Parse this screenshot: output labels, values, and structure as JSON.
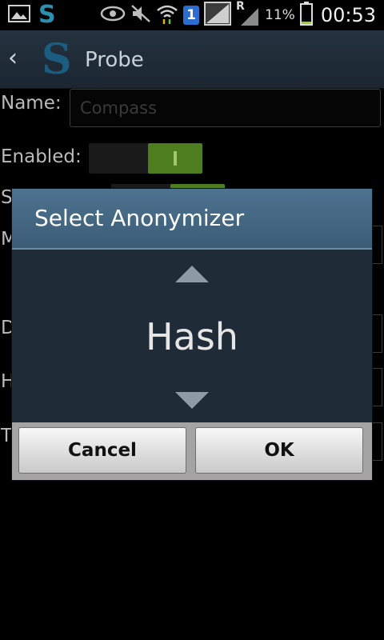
{
  "status_bar": {
    "left_icons": [
      "image-icon",
      "app-s-icon"
    ],
    "right_icons": [
      "eye-icon",
      "mute-icon",
      "wifi-icon",
      "sim-1-icon",
      "signal-icon",
      "roaming-icon"
    ],
    "app_letter": "S",
    "sim_label": "1",
    "roaming_label": "R",
    "battery_percent": "11%",
    "time": "00:53"
  },
  "action_bar": {
    "logo_letter": "S",
    "title": "Probe"
  },
  "form": {
    "name_label": "Name:",
    "name_value": "Compass",
    "enabled_label": "Enabled:",
    "row3_label": "S",
    "row4_label": "M",
    "row5_label": "D",
    "row6_label": "H",
    "row7_label": "T"
  },
  "dialog": {
    "title": "Select Anonymizer",
    "value": "Hash",
    "cancel_label": "Cancel",
    "ok_label": "OK"
  }
}
